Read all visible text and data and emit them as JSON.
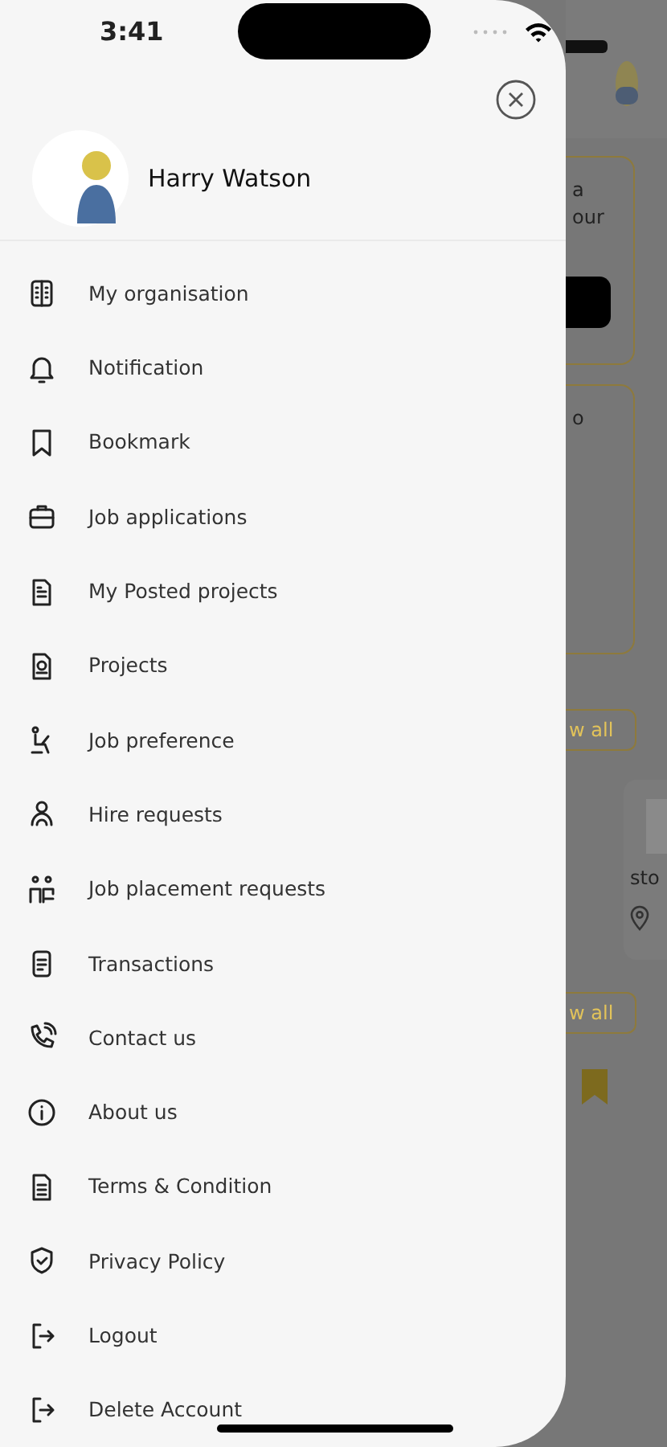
{
  "status_bar": {
    "time": "3:41"
  },
  "profile": {
    "name": "Harry Watson"
  },
  "menu": [
    {
      "label": "My organisation"
    },
    {
      "label": "Notification"
    },
    {
      "label": "Bookmark"
    },
    {
      "label": "Job applications"
    },
    {
      "label": "My Posted projects"
    },
    {
      "label": "Projects"
    },
    {
      "label": "Job preference"
    },
    {
      "label": "Hire requests"
    },
    {
      "label": "Job placement requests"
    },
    {
      "label": "Transactions"
    },
    {
      "label": "Contact us"
    },
    {
      "label": "About us"
    },
    {
      "label": "Terms & Condition"
    },
    {
      "label": "Privacy Policy"
    },
    {
      "label": "Logout"
    },
    {
      "label": "Delete Account"
    }
  ],
  "background": {
    "card_1_lines": [
      "a",
      "our"
    ],
    "card_2_text": "o",
    "view_all_buttons": [
      "w all",
      "w all"
    ],
    "item_card_text": "sto"
  }
}
